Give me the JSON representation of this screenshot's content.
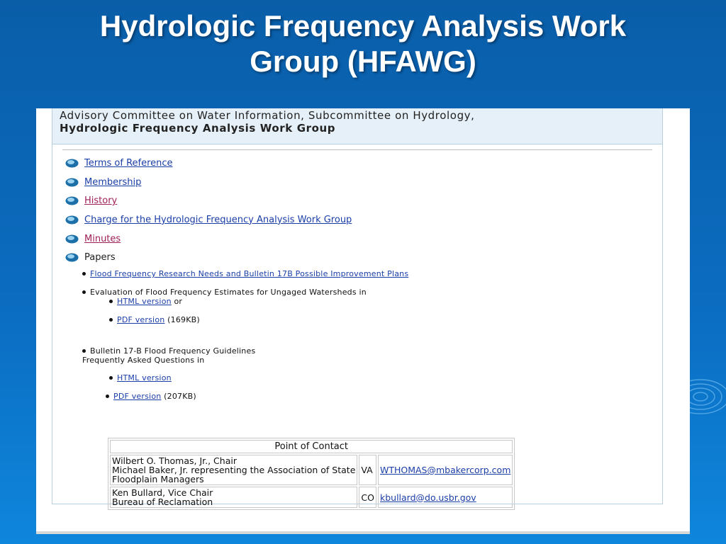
{
  "slide": {
    "title_line1": "Hydrologic Frequency Analysis Work",
    "title_line2": "Group (HFAWG)"
  },
  "page": {
    "header_line1": "Advisory Committee on Water Information, Subcommittee on Hydrology,",
    "header_line2": "Hydrologic Frequency Analysis Work Group",
    "menu": [
      {
        "label": "Terms of Reference"
      },
      {
        "label": "Membership"
      },
      {
        "label": "History"
      },
      {
        "label": "Charge for the Hydrologic Frequency Analysis Work Group"
      },
      {
        "label": "Minutes"
      },
      {
        "label": "Papers"
      }
    ],
    "papers": {
      "item1": "Flood Frequency Research Needs and Bulletin 17B Possible Improvement Plans",
      "item2": "Evaluation of Flood Frequency Estimates for Ungaged Watersheds in",
      "item2_html": "HTML version",
      "item2_or": "or",
      "item2_pdf": "PDF version",
      "item2_pdf_size": "(169KB)",
      "item3_line1": "Bulletin 17-B Flood Frequency Guidelines",
      "item3_line2": "Frequently Asked Questions in",
      "item3_html": "HTML version",
      "item3_pdf": "PDF version",
      "item3_pdf_size": "(207KB)"
    },
    "contact": {
      "heading": "Point of Contact",
      "rows": [
        {
          "name_lines": [
            "Wilbert O. Thomas, Jr., Chair",
            "Michael Baker, Jr. representing the Association of State",
            "Floodplain Managers"
          ],
          "state": "VA",
          "email": "WTHOMAS@mbakercorp.com"
        },
        {
          "name_lines": [
            "Ken Bullard, Vice Chair",
            "Bureau of Reclamation"
          ],
          "state": "CO",
          "email": "kbullard@do.usbr.gov"
        }
      ]
    }
  },
  "colors": {
    "link": "#1a3ea8",
    "visited_link": "#a0205a",
    "slide_bg": "#0b6cc0"
  },
  "icons": {
    "menu_bullet": "globe-icon",
    "decoration": "ripple-icon"
  }
}
